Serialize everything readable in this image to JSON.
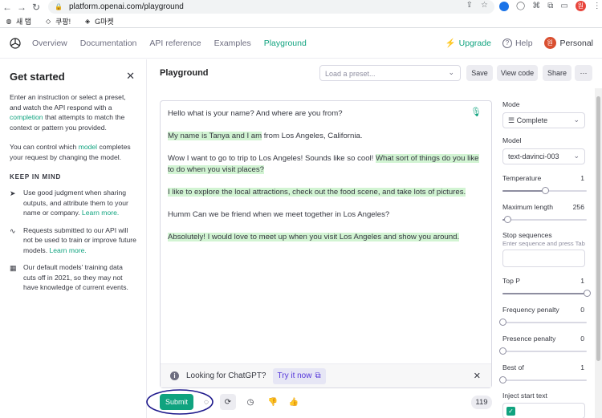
{
  "browser": {
    "url": "platform.openai.com/playground",
    "bookmarks": [
      {
        "label": "새 탭",
        "icon": "globe-icon"
      },
      {
        "label": "쿠팡!",
        "icon": "coupang-icon"
      },
      {
        "label": "G마켓",
        "icon": "gmarket-icon"
      }
    ],
    "profile_initial": "원"
  },
  "header": {
    "nav": [
      {
        "label": "Overview"
      },
      {
        "label": "Documentation"
      },
      {
        "label": "API reference"
      },
      {
        "label": "Examples"
      },
      {
        "label": "Playground",
        "active": true
      }
    ],
    "upgrade_label": "Upgrade",
    "help_label": "Help",
    "personal_label": "Personal",
    "avatar_initial": "원"
  },
  "left": {
    "title": "Get started",
    "intro_a": "Enter an instruction or select a preset, and watch the API respond with a ",
    "intro_link": "completion",
    "intro_b": " that attempts to match the context or pattern you provided.",
    "control_a": "You can control which ",
    "control_link": "model",
    "control_b": " completes your request by changing the model.",
    "keep_title": "KEEP IN MIND",
    "tips": [
      {
        "icon": "send-icon",
        "text": "Use good judgment when sharing outputs, and attribute them to your name or company. ",
        "link": "Learn more."
      },
      {
        "icon": "activity-icon",
        "text": "Requests submitted to our API will not be used to train or improve future models. ",
        "link": "Learn more."
      },
      {
        "icon": "calendar-icon",
        "text": "Our default models' training data cuts off in 2021, so they may not have knowledge of current events.",
        "link": ""
      }
    ]
  },
  "main": {
    "title": "Playground",
    "preset_placeholder": "Load a preset...",
    "save_label": "Save",
    "viewcode_label": "View code",
    "share_label": "Share",
    "more_label": "···",
    "conversation": [
      {
        "plain": "Hello what is your name? And where are you from?",
        "hl": "",
        "rest": ""
      },
      {
        "plain": "",
        "hl": "My name is Tanya and I am",
        "rest": " from Los Angeles, California."
      },
      {
        "plain": "Wow I want to go to trip to Los Angeles! Sounds like so cool! ",
        "hl": "What sort of things do you like to do when you visit places?",
        "rest": ""
      },
      {
        "plain": "",
        "hl": "I like to explore the local attractions, check out the food scene, and take lots of pictures.",
        "rest": ""
      },
      {
        "plain": "Humm Can we be friend when we meet together in Los Angeles?",
        "hl": "",
        "rest": ""
      },
      {
        "plain": "",
        "hl": "Absolutely! I would love to meet up when you visit Los Angeles and show you around.",
        "rest": ""
      }
    ],
    "chatgpt_text": "Looking for ChatGPT?",
    "try_label": "Try it now",
    "submit_label": "Submit",
    "token_count": "119"
  },
  "settings": {
    "mode_label": "Mode",
    "mode_value": "Complete",
    "model_label": "Model",
    "model_value": "text-davinci-003",
    "temperature_label": "Temperature",
    "temperature_value": "1",
    "temperature_level": 0.5,
    "max_length_label": "Maximum length",
    "max_length_value": "256",
    "max_length_level": 0.06,
    "stop_label": "Stop sequences",
    "stop_hint": "Enter sequence and press Tab",
    "top_p_label": "Top P",
    "top_p_value": "1",
    "top_p_level": 1.0,
    "freq_label": "Frequency penalty",
    "freq_value": "0",
    "freq_level": 0.0,
    "presence_label": "Presence penalty",
    "presence_value": "0",
    "presence_level": 0.0,
    "best_of_label": "Best of",
    "best_of_value": "1",
    "best_of_level": 0.0,
    "inject_label": "Inject start text"
  },
  "colors": {
    "accent": "#10a37f",
    "highlight": "#d2f4d3",
    "annotation_circle": "#1f1a8c"
  }
}
